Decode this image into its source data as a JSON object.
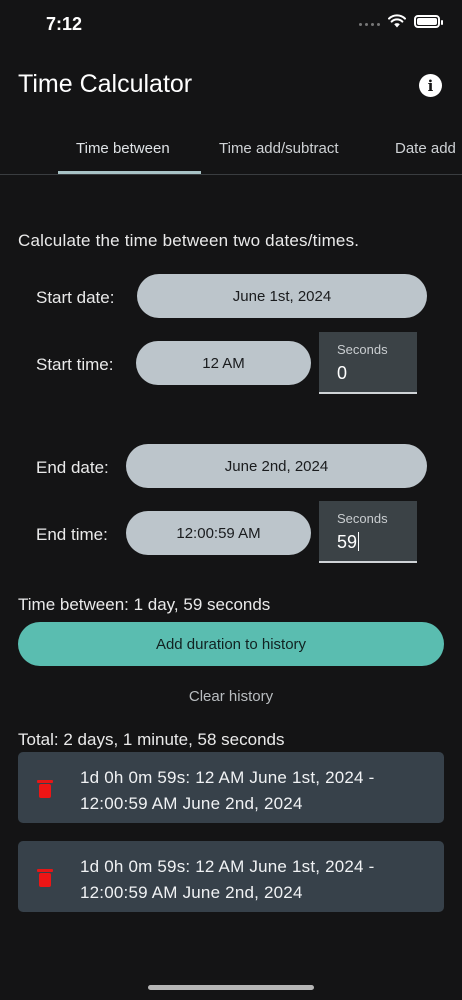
{
  "status_bar": {
    "time": "7:12",
    "icons": [
      "signal-dots-icon",
      "wifi-icon",
      "battery-icon"
    ]
  },
  "header": {
    "title": "Time Calculator",
    "info_icon": "info-icon"
  },
  "tabs": [
    {
      "label": "Time between",
      "active": true
    },
    {
      "label": "Time add/subtract",
      "active": false
    },
    {
      "label": "Date add",
      "active": false
    }
  ],
  "calculator": {
    "description": "Calculate the time between two dates/times.",
    "start": {
      "date_label": "Start date:",
      "date_value": "June 1st, 2024",
      "time_label": "Start time:",
      "time_value": "12 AM",
      "seconds_label": "Seconds",
      "seconds_value": "0"
    },
    "end": {
      "date_label": "End date:",
      "date_value": "June 2nd, 2024",
      "time_label": "End time:",
      "time_value": "12:00:59 AM",
      "seconds_label": "Seconds",
      "seconds_value": "59"
    },
    "result": "Time between: 1 day, 59 seconds",
    "add_button": "Add duration to history",
    "clear_button": "Clear history"
  },
  "history": {
    "total": "Total: 2 days, 1 minute, 58 seconds",
    "items": [
      {
        "text": "1d 0h 0m 59s: 12 AM June 1st, 2024 - 12:00:59 AM June 2nd, 2024"
      },
      {
        "text": "1d 0h 0m 59s: 12 AM June 1st, 2024 - 12:00:59 AM June 2nd, 2024"
      }
    ]
  },
  "colors": {
    "background": "#141415",
    "pill": "#bcc5cb",
    "accent_button": "#5abdb0",
    "card": "#37414a",
    "delete_icon": "#ee1515"
  }
}
